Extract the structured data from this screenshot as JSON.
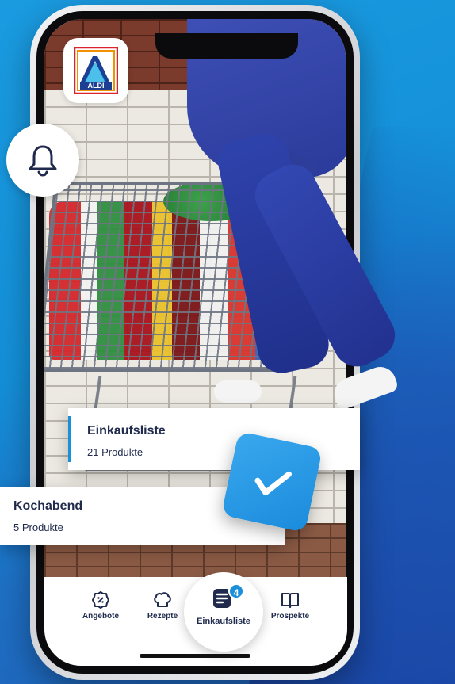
{
  "brand": {
    "logo_text": "ALDI",
    "accent": "#1c8fd9",
    "navy": "#1f2a4d"
  },
  "notifications": {
    "icon": "bell-icon"
  },
  "lists": [
    {
      "title": "Einkaufsliste",
      "count": "21 Produkte",
      "checked": true
    },
    {
      "title": "Kochabend",
      "count": "5 Produkte"
    }
  ],
  "tabbar": {
    "angebote": {
      "label": "Angebote",
      "icon": "badge-percent-icon"
    },
    "rezepte": {
      "label": "Rezepte",
      "icon": "chef-hat-icon"
    },
    "einkaufsliste": {
      "label": "Einkaufsliste",
      "icon": "list-icon",
      "badge": "4"
    },
    "prospekte": {
      "label": "Prospekte",
      "icon": "book-icon"
    }
  }
}
